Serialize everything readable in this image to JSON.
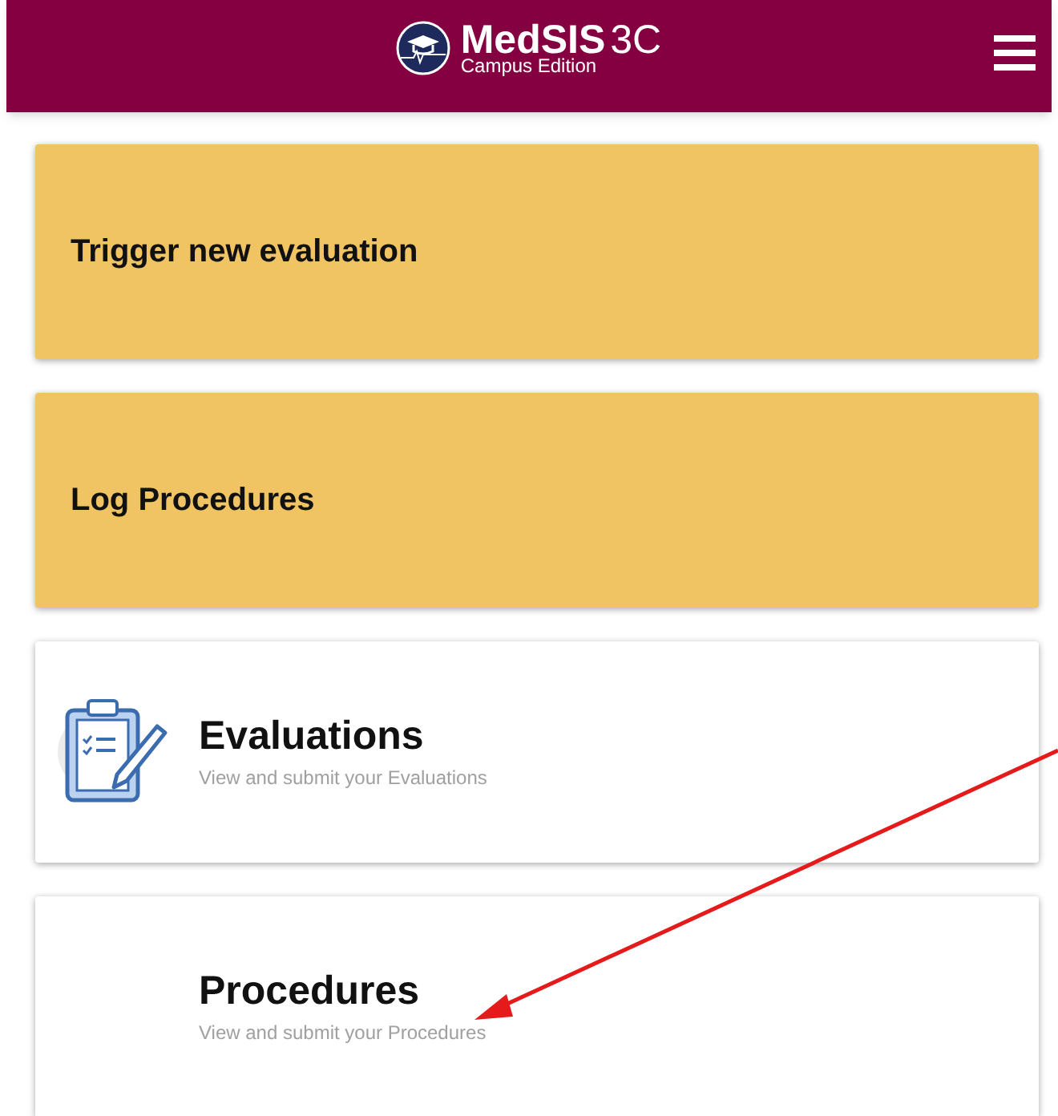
{
  "header": {
    "brand": "MedSIS",
    "version": "3C",
    "edition": "Campus Edition"
  },
  "cards": [
    {
      "kind": "action",
      "title": "Trigger new evaluation"
    },
    {
      "kind": "action",
      "title": "Log Procedures"
    },
    {
      "kind": "module",
      "title": "Evaluations",
      "subtitle": "View and submit your Evaluations",
      "has_icon": true
    },
    {
      "kind": "module",
      "title": "Procedures",
      "subtitle": "View and submit your Procedures",
      "has_icon": false
    }
  ]
}
